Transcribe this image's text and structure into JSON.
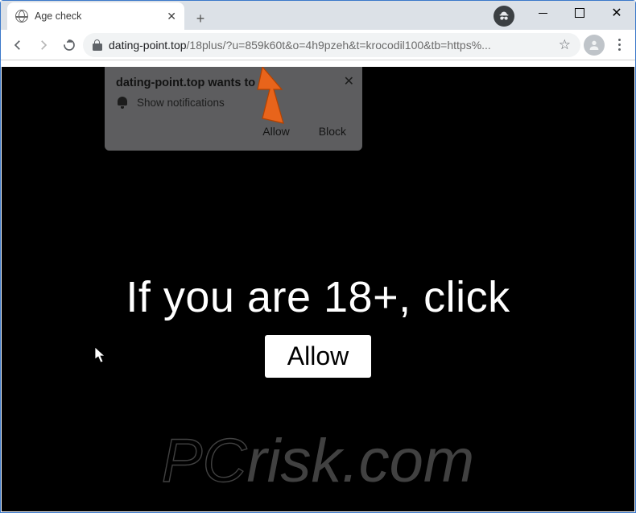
{
  "window": {
    "controls": {
      "minimize": "",
      "maximize": "",
      "close": "✕"
    }
  },
  "tab": {
    "title": "Age check",
    "close_glyph": "✕",
    "newtab_glyph": "+"
  },
  "address": {
    "domain": "dating-point.top",
    "path": "/18plus/?u=859k60t&o=4h9pzeh&t=krocodil100&tb=https%..."
  },
  "notification": {
    "title": "dating-point.top wants to",
    "message": "Show notifications",
    "allow": "Allow",
    "block": "Block",
    "close_glyph": "✕"
  },
  "page": {
    "heading": "If you are 18+, click",
    "allow_button": "Allow"
  },
  "watermark": {
    "text_prefix": "PC",
    "text_suffix": "risk.com"
  }
}
